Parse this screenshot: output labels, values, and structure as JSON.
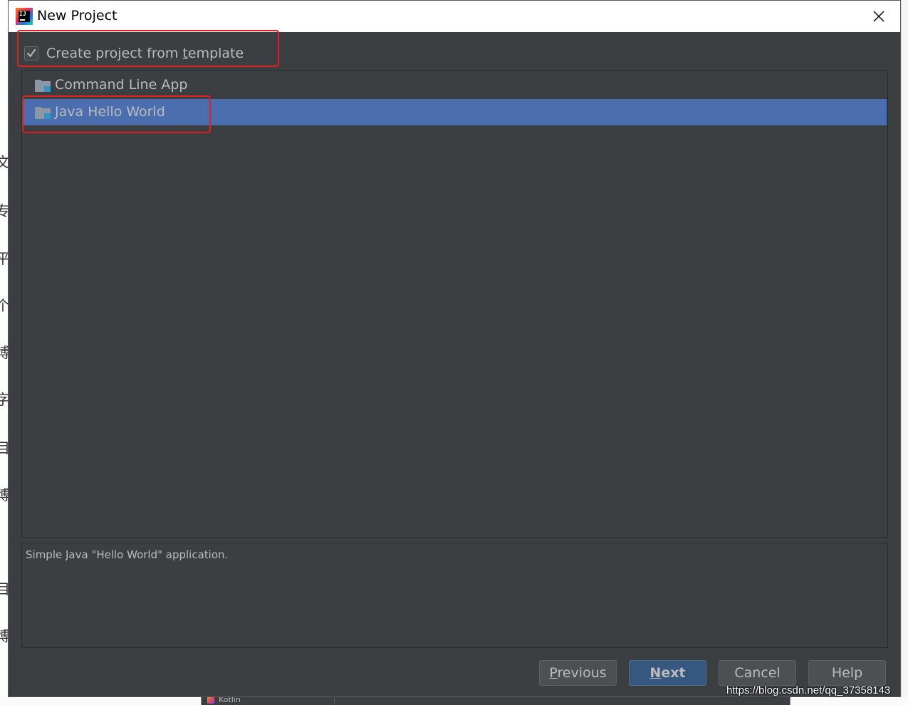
{
  "window": {
    "title": "New Project",
    "close_label": "✕"
  },
  "background": {
    "left_chars": [
      "文",
      "专",
      "平",
      "个",
      "博",
      "字",
      "目",
      "博",
      "目",
      "博"
    ],
    "kotlin_label": "Kotlin"
  },
  "template_option": {
    "checked": true,
    "label_before": "Create project from ",
    "label_mnemonic": "t",
    "label_after": "emplate"
  },
  "template_list": {
    "items": [
      {
        "label": "Command Line App",
        "selected": false
      },
      {
        "label": "Java Hello World",
        "selected": true
      }
    ]
  },
  "description": {
    "text": "Simple Java \"Hello World\" application."
  },
  "buttons": {
    "previous": {
      "mnemonic": "P",
      "rest": "revious"
    },
    "next": {
      "mnemonic": "N",
      "rest": "ext"
    },
    "cancel": {
      "label": "Cancel"
    },
    "help": {
      "label": "Help"
    }
  },
  "watermark": "https://blog.csdn.net/qq_37358143",
  "colors": {
    "dialog_bg": "#3c3f41",
    "selection": "#4b6eaf",
    "default_button": "#365880",
    "annotation": "#e02020"
  }
}
